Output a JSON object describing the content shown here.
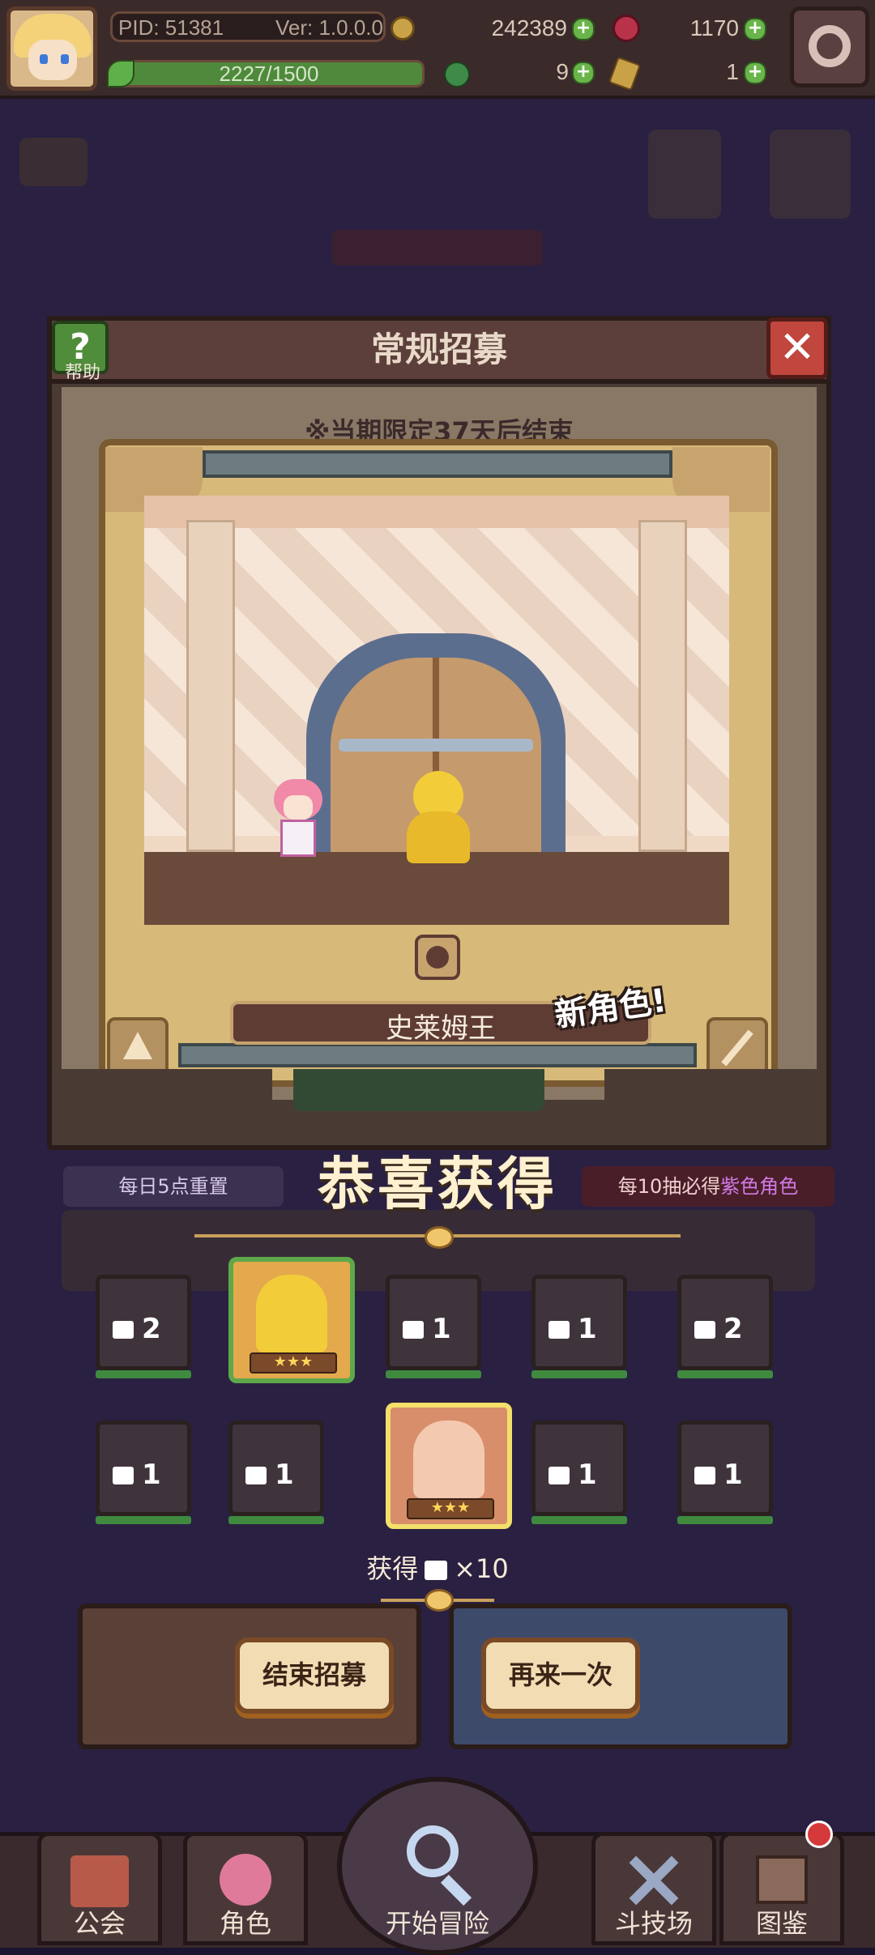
{
  "top_bar": {
    "pid": "PID: 51381",
    "version": "Ver: 1.0.0.0",
    "gold": "242389",
    "gems": "1170",
    "stamina": "2227/1500",
    "stamina_ratio": 1.0,
    "clover": "9",
    "ticket": "1"
  },
  "panel": {
    "title": "常规招募",
    "help_label": "帮助",
    "period_text": "※当期限定37天后结束"
  },
  "reveal": {
    "character_name": "史莱姆王",
    "new_tag": "新角色!"
  },
  "congrats": "恭喜获得",
  "banners": {
    "daily_reset": "每日5点重置",
    "guarantee_prefix": "每10抽必得",
    "guarantee_highlight": "紫色角色"
  },
  "results": {
    "row1": [
      {
        "count": "2",
        "stars": "",
        "featured": false
      },
      {
        "count": "",
        "stars": "★★★",
        "featured": true,
        "frame": "green"
      },
      {
        "count": "1",
        "stars": "",
        "featured": false
      },
      {
        "count": "1",
        "stars": "",
        "featured": false
      },
      {
        "count": "2",
        "stars": "",
        "featured": false
      }
    ],
    "row2": [
      {
        "count": "1",
        "stars": "",
        "featured": false
      },
      {
        "count": "1",
        "stars": "",
        "featured": false
      },
      {
        "count": "",
        "stars": "★★★",
        "featured": true,
        "frame": "yellow"
      },
      {
        "count": "1",
        "stars": "",
        "featured": false
      },
      {
        "count": "1",
        "stars": "",
        "featured": false
      }
    ]
  },
  "gain": {
    "prefix": "获得",
    "suffix": "×10"
  },
  "buttons": {
    "end": "结束招募",
    "again": "再来一次"
  },
  "nav": [
    "公会",
    "角色",
    "开始冒险",
    "斗技场",
    "图鉴"
  ],
  "colors": {
    "accent_gold": "#d7b979",
    "frame_green": "#5ea84a",
    "frame_yellow": "#f2e06a",
    "highlight_purple": "#d27ae6"
  }
}
